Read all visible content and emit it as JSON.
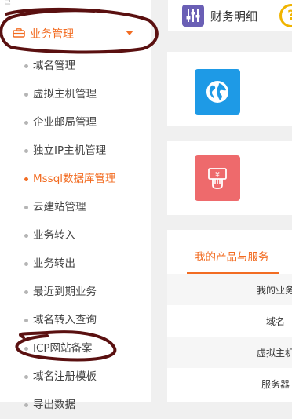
{
  "sidebar": {
    "section_title": "业务管理",
    "items": [
      {
        "label": "域名管理"
      },
      {
        "label": "虚拟主机管理"
      },
      {
        "label": "企业邮局管理"
      },
      {
        "label": "独立IP主机管理"
      },
      {
        "label": "Mssql数据库管理",
        "active": true
      },
      {
        "label": "云建站管理"
      },
      {
        "label": "业务转入"
      },
      {
        "label": "业务转出"
      },
      {
        "label": "最近到期业务"
      },
      {
        "label": "域名转入查询"
      },
      {
        "label": "ICP网站备案"
      },
      {
        "label": "域名注册模板"
      },
      {
        "label": "导出数据"
      }
    ]
  },
  "header": {
    "finance_label": "财务明细",
    "help_symbol": "?"
  },
  "tiles": {
    "globe_icon": "globe-icon",
    "money_icon": "money-icon"
  },
  "products": {
    "tab_label": "我的产品与服务",
    "rows": [
      {
        "label": "我的业务"
      },
      {
        "label": "域名"
      },
      {
        "label": "虚拟主机"
      },
      {
        "label": "服务器"
      }
    ]
  },
  "colors": {
    "accent": "#f26c22",
    "finance_icon_bg": "#6a5fb5",
    "globe_tile": "#1e9ae6",
    "money_tile": "#ee6a6c",
    "help_ring": "#f0b400",
    "annotation": "#5a1010"
  }
}
